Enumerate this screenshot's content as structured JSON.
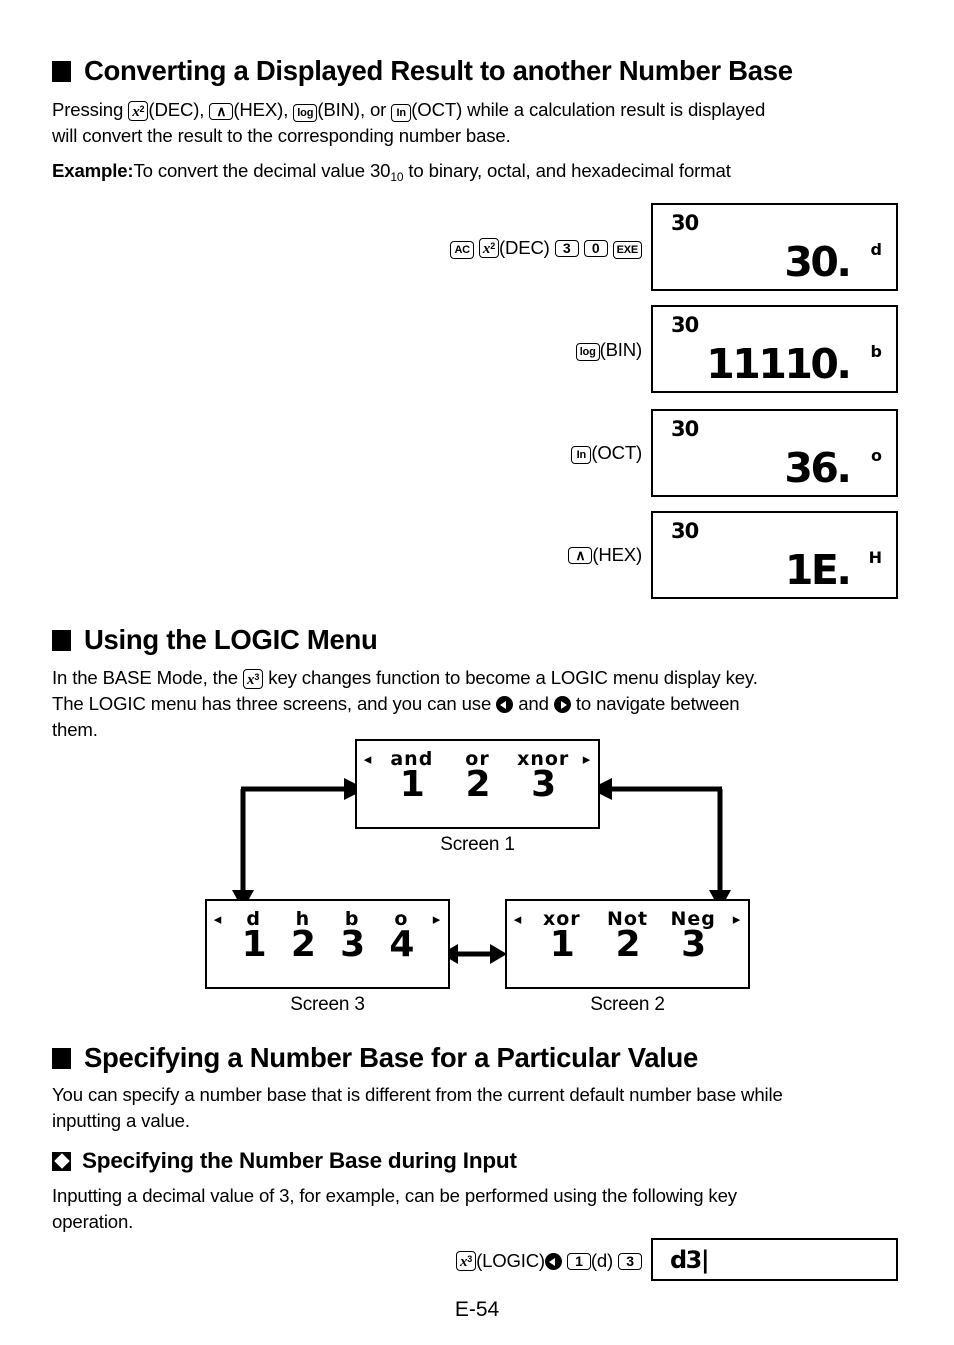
{
  "page": {
    "footer": "E-54"
  },
  "section1": {
    "heading": "Converting a Displayed Result to another Number Base",
    "para_lead": "Pressing",
    "para_mid1": "(DEC),",
    "para_mid2": "(HEX),",
    "para_mid3": "(BIN), or",
    "para_mid4": "(OCT) while a calculation result is displayed",
    "para_line2": "will convert the result to the corresponding number base.",
    "example_label": "Example:",
    "example_text_a": "To convert the decimal value 30",
    "example_sub": "10",
    "example_text_b": " to binary, octal, and hexadecimal format",
    "keys": {
      "x2": "x",
      "x2_sup": "2",
      "hex": "∧",
      "log": "log",
      "ln": "In"
    },
    "examples": [
      {
        "keyseq": [
          {
            "type": "key",
            "label": "AC"
          },
          {
            "type": "key-x2",
            "label": "x",
            "sup": "2"
          },
          {
            "type": "text",
            "label": "(DEC)"
          },
          {
            "type": "key",
            "label": "3"
          },
          {
            "type": "key",
            "label": "0"
          },
          {
            "type": "key",
            "label": "EXE"
          }
        ],
        "lcd_top": "30",
        "lcd_main": "30",
        "lcd_flag": "d"
      },
      {
        "keyseq": [
          {
            "type": "key",
            "label": "log"
          },
          {
            "type": "text",
            "label": "(BIN)"
          }
        ],
        "lcd_top": "30",
        "lcd_main": "11110",
        "lcd_flag": "b"
      },
      {
        "keyseq": [
          {
            "type": "key",
            "label": "In"
          },
          {
            "type": "text",
            "label": "(OCT)"
          }
        ],
        "lcd_top": "30",
        "lcd_main": "36",
        "lcd_flag": "o"
      },
      {
        "keyseq": [
          {
            "type": "key",
            "label": "∧"
          },
          {
            "type": "text",
            "label": "(HEX)"
          }
        ],
        "lcd_top": "30",
        "lcd_main": "1E",
        "lcd_flag": "H"
      }
    ]
  },
  "section2": {
    "heading": "Using the LOGIC Menu",
    "para_a": "In the BASE Mode, the",
    "para_b": "key changes function to become a LOGIC menu display key.",
    "para_c": "The LOGIC menu has three screens, and you can use",
    "para_d": "and",
    "para_e": "to navigate between",
    "para_f": "them.",
    "key_x3": "x",
    "key_x3_sup": "3",
    "screens": [
      {
        "caption": "Screen 1",
        "left_arrow": "◂",
        "right_arrow": "▸",
        "labels": [
          "and",
          "or",
          "xnor"
        ],
        "numbers": [
          "1",
          "2",
          "3"
        ]
      },
      {
        "caption": "Screen 2",
        "left_arrow": "◂",
        "right_arrow": "▸",
        "labels": [
          "xor",
          "Not",
          "Neg"
        ],
        "numbers": [
          "1",
          "2",
          "3"
        ]
      },
      {
        "caption": "Screen 3",
        "left_arrow": "◂",
        "right_arrow": "▸",
        "labels": [
          "d",
          "h",
          "b",
          "o"
        ],
        "numbers": [
          "1",
          "2",
          "3",
          "4"
        ]
      }
    ]
  },
  "section3": {
    "heading": "Specifying a Number Base for a Particular Value",
    "para_line1": "You can specify a number base that is different from the current default number base while",
    "para_line2": "inputting a value."
  },
  "section4": {
    "heading": "Specifying the Number Base during Input",
    "para_line1": "Inputting a decimal value of 3, for example, can be performed using the following key",
    "para_line2": "operation.",
    "keyseq": {
      "key_x3": "x",
      "key_x3_sup": "3",
      "logic_text": "(LOGIC)",
      "cursor_left": "left-arrow",
      "key_1": "1",
      "d_text": "(d)",
      "key_3": "3"
    },
    "lcd_value": "d3|"
  },
  "colors": {
    "ink": "#000000",
    "paper": "#ffffff"
  }
}
